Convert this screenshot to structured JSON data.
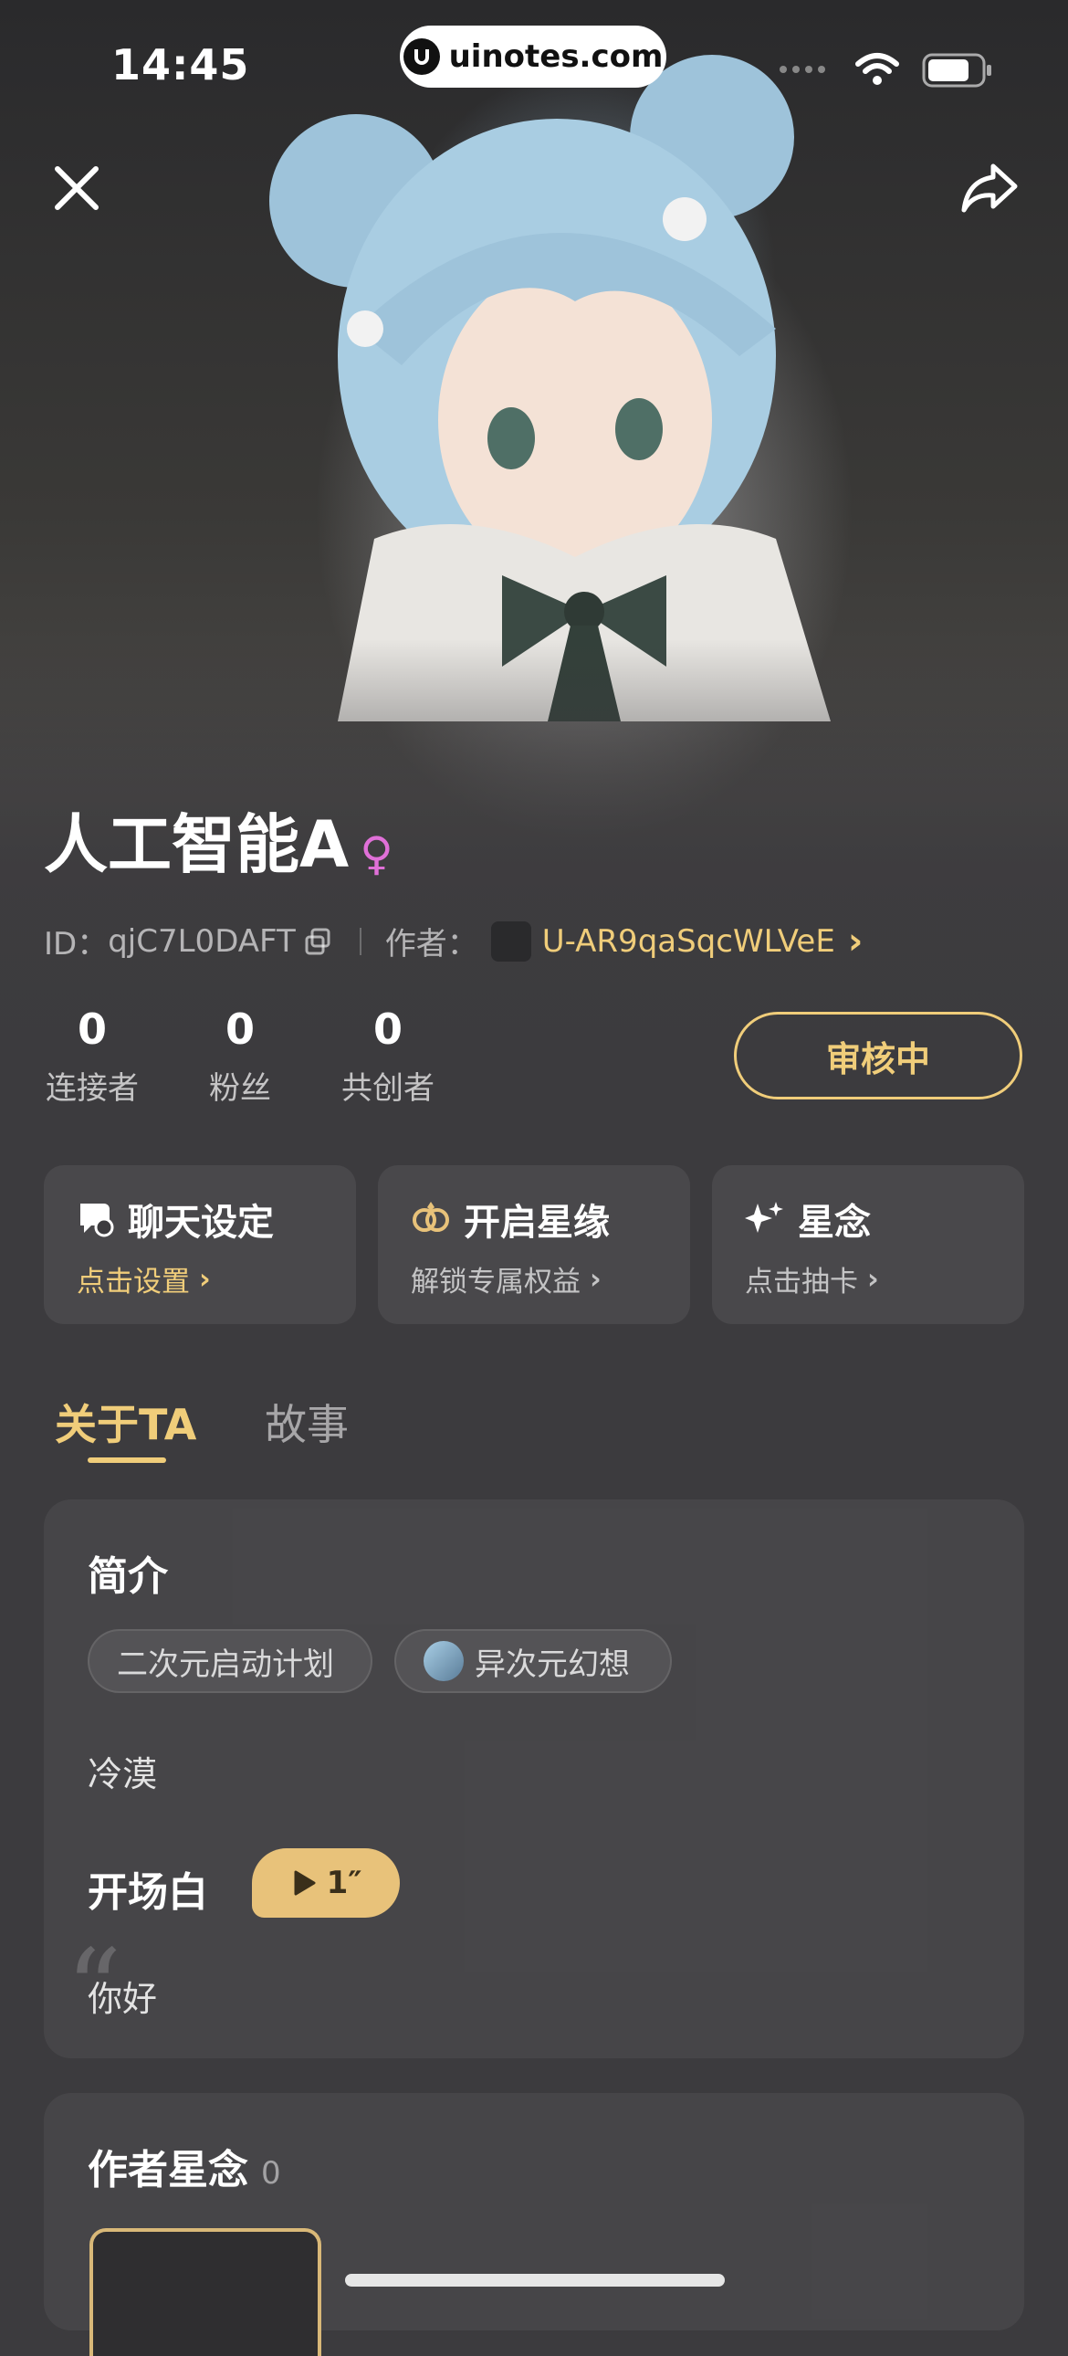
{
  "status_bar": {
    "time": "14:45",
    "url": "uinotes.com"
  },
  "header": {
    "close_icon": "close-icon",
    "share_icon": "share-icon"
  },
  "profile": {
    "name": "人工智能A",
    "gender_symbol": "♀",
    "id_label": "ID：",
    "id_value": "qjC7L0DAFT",
    "author_label": "作者：",
    "author_name": "U-AR9qaSqcWLVeE",
    "author_chevron": "›"
  },
  "stats": [
    {
      "value": "0",
      "label": "连接者"
    },
    {
      "value": "0",
      "label": "粉丝"
    },
    {
      "value": "0",
      "label": "共创者"
    }
  ],
  "review_button": "审核中",
  "cards": [
    {
      "title": "聊天设定",
      "subtitle": "点击设置",
      "chevron": "›"
    },
    {
      "title": "开启星缘",
      "subtitle": "解锁专属权益",
      "chevron": "›"
    },
    {
      "title": "星念",
      "subtitle": "点击抽卡",
      "chevron": "›"
    }
  ],
  "tabs": [
    {
      "label": "关于TA",
      "active": true
    },
    {
      "label": "故事",
      "active": false
    }
  ],
  "about": {
    "intro_title": "简介",
    "tags": [
      "二次元启动计划",
      "异次元幻想"
    ],
    "description": "冷漠",
    "opening_title": "开场白",
    "voice_duration": "1″",
    "opening_text": "你好",
    "quote_mark": "“"
  },
  "author_stars": {
    "title": "作者星念",
    "count": "0"
  },
  "colors": {
    "accent_gold": "#f0cd7a",
    "background": "#3c3b3e",
    "gender": "#e070d8"
  }
}
